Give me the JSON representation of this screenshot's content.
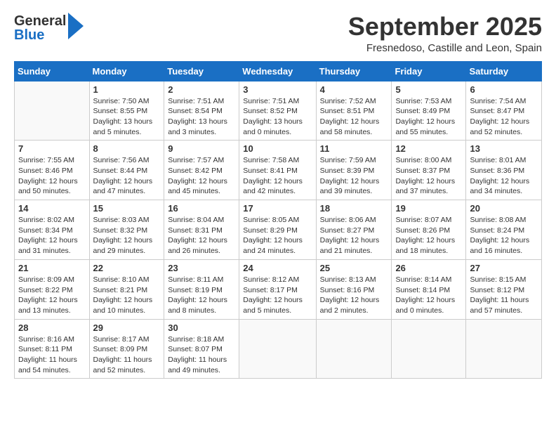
{
  "header": {
    "logo_general": "General",
    "logo_blue": "Blue",
    "month": "September 2025",
    "location": "Fresnedoso, Castille and Leon, Spain"
  },
  "weekdays": [
    "Sunday",
    "Monday",
    "Tuesday",
    "Wednesday",
    "Thursday",
    "Friday",
    "Saturday"
  ],
  "weeks": [
    [
      {
        "day": "",
        "sunrise": "",
        "sunset": "",
        "daylight": ""
      },
      {
        "day": "1",
        "sunrise": "Sunrise: 7:50 AM",
        "sunset": "Sunset: 8:55 PM",
        "daylight": "Daylight: 13 hours and 5 minutes."
      },
      {
        "day": "2",
        "sunrise": "Sunrise: 7:51 AM",
        "sunset": "Sunset: 8:54 PM",
        "daylight": "Daylight: 13 hours and 3 minutes."
      },
      {
        "day": "3",
        "sunrise": "Sunrise: 7:51 AM",
        "sunset": "Sunset: 8:52 PM",
        "daylight": "Daylight: 13 hours and 0 minutes."
      },
      {
        "day": "4",
        "sunrise": "Sunrise: 7:52 AM",
        "sunset": "Sunset: 8:51 PM",
        "daylight": "Daylight: 12 hours and 58 minutes."
      },
      {
        "day": "5",
        "sunrise": "Sunrise: 7:53 AM",
        "sunset": "Sunset: 8:49 PM",
        "daylight": "Daylight: 12 hours and 55 minutes."
      },
      {
        "day": "6",
        "sunrise": "Sunrise: 7:54 AM",
        "sunset": "Sunset: 8:47 PM",
        "daylight": "Daylight: 12 hours and 52 minutes."
      }
    ],
    [
      {
        "day": "7",
        "sunrise": "Sunrise: 7:55 AM",
        "sunset": "Sunset: 8:46 PM",
        "daylight": "Daylight: 12 hours and 50 minutes."
      },
      {
        "day": "8",
        "sunrise": "Sunrise: 7:56 AM",
        "sunset": "Sunset: 8:44 PM",
        "daylight": "Daylight: 12 hours and 47 minutes."
      },
      {
        "day": "9",
        "sunrise": "Sunrise: 7:57 AM",
        "sunset": "Sunset: 8:42 PM",
        "daylight": "Daylight: 12 hours and 45 minutes."
      },
      {
        "day": "10",
        "sunrise": "Sunrise: 7:58 AM",
        "sunset": "Sunset: 8:41 PM",
        "daylight": "Daylight: 12 hours and 42 minutes."
      },
      {
        "day": "11",
        "sunrise": "Sunrise: 7:59 AM",
        "sunset": "Sunset: 8:39 PM",
        "daylight": "Daylight: 12 hours and 39 minutes."
      },
      {
        "day": "12",
        "sunrise": "Sunrise: 8:00 AM",
        "sunset": "Sunset: 8:37 PM",
        "daylight": "Daylight: 12 hours and 37 minutes."
      },
      {
        "day": "13",
        "sunrise": "Sunrise: 8:01 AM",
        "sunset": "Sunset: 8:36 PM",
        "daylight": "Daylight: 12 hours and 34 minutes."
      }
    ],
    [
      {
        "day": "14",
        "sunrise": "Sunrise: 8:02 AM",
        "sunset": "Sunset: 8:34 PM",
        "daylight": "Daylight: 12 hours and 31 minutes."
      },
      {
        "day": "15",
        "sunrise": "Sunrise: 8:03 AM",
        "sunset": "Sunset: 8:32 PM",
        "daylight": "Daylight: 12 hours and 29 minutes."
      },
      {
        "day": "16",
        "sunrise": "Sunrise: 8:04 AM",
        "sunset": "Sunset: 8:31 PM",
        "daylight": "Daylight: 12 hours and 26 minutes."
      },
      {
        "day": "17",
        "sunrise": "Sunrise: 8:05 AM",
        "sunset": "Sunset: 8:29 PM",
        "daylight": "Daylight: 12 hours and 24 minutes."
      },
      {
        "day": "18",
        "sunrise": "Sunrise: 8:06 AM",
        "sunset": "Sunset: 8:27 PM",
        "daylight": "Daylight: 12 hours and 21 minutes."
      },
      {
        "day": "19",
        "sunrise": "Sunrise: 8:07 AM",
        "sunset": "Sunset: 8:26 PM",
        "daylight": "Daylight: 12 hours and 18 minutes."
      },
      {
        "day": "20",
        "sunrise": "Sunrise: 8:08 AM",
        "sunset": "Sunset: 8:24 PM",
        "daylight": "Daylight: 12 hours and 16 minutes."
      }
    ],
    [
      {
        "day": "21",
        "sunrise": "Sunrise: 8:09 AM",
        "sunset": "Sunset: 8:22 PM",
        "daylight": "Daylight: 12 hours and 13 minutes."
      },
      {
        "day": "22",
        "sunrise": "Sunrise: 8:10 AM",
        "sunset": "Sunset: 8:21 PM",
        "daylight": "Daylight: 12 hours and 10 minutes."
      },
      {
        "day": "23",
        "sunrise": "Sunrise: 8:11 AM",
        "sunset": "Sunset: 8:19 PM",
        "daylight": "Daylight: 12 hours and 8 minutes."
      },
      {
        "day": "24",
        "sunrise": "Sunrise: 8:12 AM",
        "sunset": "Sunset: 8:17 PM",
        "daylight": "Daylight: 12 hours and 5 minutes."
      },
      {
        "day": "25",
        "sunrise": "Sunrise: 8:13 AM",
        "sunset": "Sunset: 8:16 PM",
        "daylight": "Daylight: 12 hours and 2 minutes."
      },
      {
        "day": "26",
        "sunrise": "Sunrise: 8:14 AM",
        "sunset": "Sunset: 8:14 PM",
        "daylight": "Daylight: 12 hours and 0 minutes."
      },
      {
        "day": "27",
        "sunrise": "Sunrise: 8:15 AM",
        "sunset": "Sunset: 8:12 PM",
        "daylight": "Daylight: 11 hours and 57 minutes."
      }
    ],
    [
      {
        "day": "28",
        "sunrise": "Sunrise: 8:16 AM",
        "sunset": "Sunset: 8:11 PM",
        "daylight": "Daylight: 11 hours and 54 minutes."
      },
      {
        "day": "29",
        "sunrise": "Sunrise: 8:17 AM",
        "sunset": "Sunset: 8:09 PM",
        "daylight": "Daylight: 11 hours and 52 minutes."
      },
      {
        "day": "30",
        "sunrise": "Sunrise: 8:18 AM",
        "sunset": "Sunset: 8:07 PM",
        "daylight": "Daylight: 11 hours and 49 minutes."
      },
      {
        "day": "",
        "sunrise": "",
        "sunset": "",
        "daylight": ""
      },
      {
        "day": "",
        "sunrise": "",
        "sunset": "",
        "daylight": ""
      },
      {
        "day": "",
        "sunrise": "",
        "sunset": "",
        "daylight": ""
      },
      {
        "day": "",
        "sunrise": "",
        "sunset": "",
        "daylight": ""
      }
    ]
  ]
}
